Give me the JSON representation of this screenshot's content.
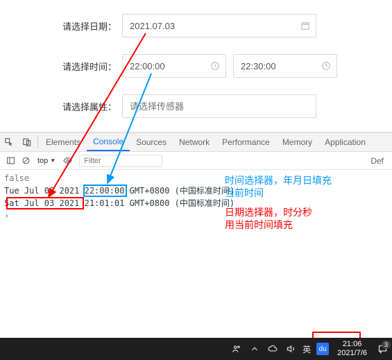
{
  "form": {
    "date_label": "请选择日期：",
    "date_value": "2021.07.03",
    "time_label": "请选择时间：",
    "time_from": "22:00:00",
    "time_to": "22:30:00",
    "attr_label": "请选择属性：",
    "attr_placeholder": "请选择传感器"
  },
  "devtools": {
    "tabs": {
      "elements": "Elements",
      "console": "Console",
      "sources": "Sources",
      "network": "Network",
      "performance": "Performance",
      "memory": "Memory",
      "application": "Application"
    }
  },
  "console_bar": {
    "top": "top",
    "filter_placeholder": "Filter",
    "default": "Def"
  },
  "console": {
    "line1": "false",
    "line2_a": "Tue Jul 06 2021 ",
    "line2_b": "22:00:00",
    "line2_c": " GMT+0800 (中国标准时间)",
    "line3_a": "Sat Jul 03 2021",
    "line3_b": " 21:01:01 GMT+0800 (中国标准时间)"
  },
  "annotations": {
    "a1": "时间选择器，年月日填充",
    "a2": "当前时间",
    "a3": "日期选择器，时分秒",
    "a4": "用当前时间填充"
  },
  "colors": {
    "blue": "#0099ff",
    "red": "#ff0000"
  },
  "taskbar": {
    "ime": "英",
    "du": "du",
    "time": "21:06",
    "date": "2021/7/6",
    "notif_count": "3"
  }
}
